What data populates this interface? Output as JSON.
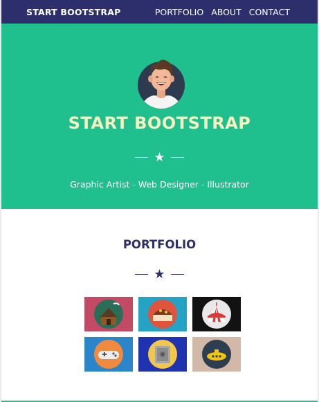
{
  "nav": {
    "brand": "START BOOTSTRAP",
    "links": [
      "PORTFOLIO",
      "ABOUT",
      "CONTACT"
    ]
  },
  "hero": {
    "title": "START BOOTSTRAP",
    "divider_glyph": "★",
    "tagline": "Graphic Artist - Web Designer - Illustrator"
  },
  "portfolio": {
    "title": "PORTFOLIO",
    "divider_glyph": "★",
    "items": [
      {
        "icon": "cabin-icon",
        "bg": "#c24a64"
      },
      {
        "icon": "cake-icon",
        "bg": "#24a3c4"
      },
      {
        "icon": "circus-tent-icon",
        "bg": "#121212"
      },
      {
        "icon": "game-controller-icon",
        "bg": "#2a86c9"
      },
      {
        "icon": "safe-icon",
        "bg": "#1f33b1"
      },
      {
        "icon": "submarine-icon",
        "bg": "#d2b8a6"
      }
    ]
  },
  "colors": {
    "nav": "#2c2f6c",
    "hero": "#1fbf8e",
    "hero_title": "#f7f0c0",
    "section_title": "#2c2f6c"
  }
}
